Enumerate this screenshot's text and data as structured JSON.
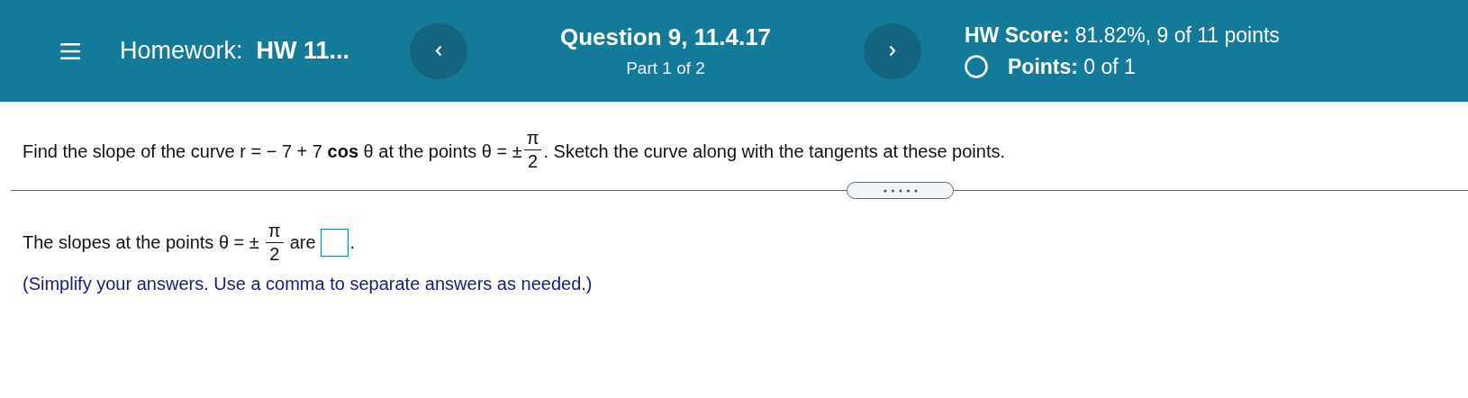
{
  "header": {
    "homework_label": "Homework:",
    "homework_title": "HW 11...",
    "question_title": "Question 9, 11.4.17",
    "part": "Part 1 of 2",
    "score_label": "HW Score:",
    "score_value": "81.82%, 9 of 11 points",
    "points_label": "Points:",
    "points_value": "0 of 1"
  },
  "question": {
    "parts": [
      {
        "kind": "text",
        "text": "Find the slope of the curve r = − 7 + 7 **cos** θ at the points θ = ±"
      },
      {
        "kind": "fraction",
        "numerator": "π",
        "denominator": "2"
      },
      {
        "kind": "text",
        "text": ". Sketch the curve along with the tangents at these points."
      }
    ]
  },
  "answer": {
    "parts": [
      {
        "kind": "text",
        "text": "The slopes at the points θ = ±"
      },
      {
        "kind": "fraction",
        "numerator": "π",
        "denominator": "2"
      },
      {
        "kind": "text",
        "text": "are"
      },
      {
        "kind": "input"
      },
      {
        "kind": "text",
        "text": "."
      }
    ],
    "instruction": "(Simplify your answers. Use a comma to separate answers as needed.)"
  }
}
